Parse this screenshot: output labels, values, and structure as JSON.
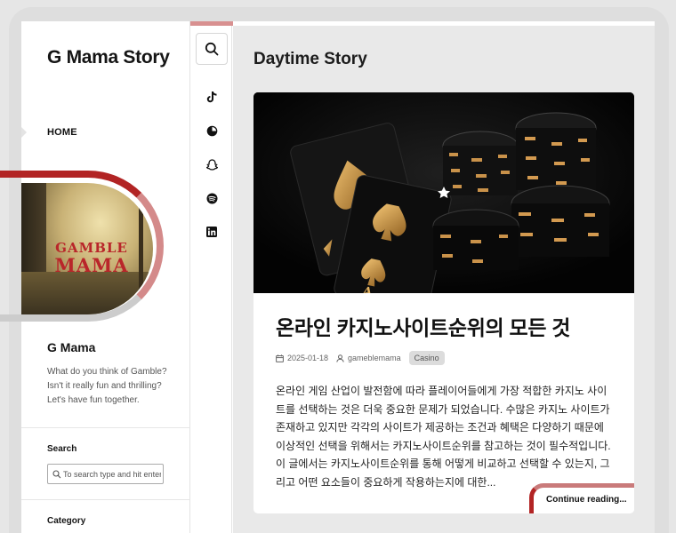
{
  "site": {
    "title": "G Mama Story"
  },
  "nav": {
    "items": [
      {
        "label": "HOME"
      }
    ]
  },
  "logo": {
    "line1": "GAMBLE",
    "line2": "MAMA"
  },
  "author": {
    "name": "G Mama",
    "bio": "What do you think of Gamble? Isn't it really fun and thrilling? Let's have fun together."
  },
  "widgets": {
    "search_title": "Search",
    "search_placeholder": "To search type and hit enter",
    "category_title": "Category"
  },
  "rail": {
    "icons": [
      "search-icon",
      "tiktok-icon",
      "pie-icon",
      "snapchat-icon",
      "spotify-icon",
      "linkedin-icon"
    ]
  },
  "main": {
    "heading": "Daytime Story",
    "post": {
      "title": "온라인 카지노사이트순위의 모든 것",
      "date": "2025-01-18",
      "author": "gameblemama",
      "category": "Casino",
      "excerpt": "온라인 게임 산업이 발전함에 따라 플레이어들에게 가장 적합한 카지노 사이트를 선택하는 것은 더욱 중요한 문제가 되었습니다. 수많은 카지노 사이트가 존재하고 있지만 각각의 사이트가 제공하는 조건과 혜택은 다양하기 때문에 이상적인 선택을 위해서는 카지노사이트순위를 참고하는 것이 필수적입니다. 이 글에서는 카지노사이트순위를 통해 어떻게 비교하고 선택할 수 있는지, 그리고 어떤 요소들이 중요하게 작용하는지에 대한...",
      "continue_label": "Continue reading..."
    }
  },
  "colors": {
    "accent": "#b22424",
    "accent_light": "#d48a8a"
  }
}
